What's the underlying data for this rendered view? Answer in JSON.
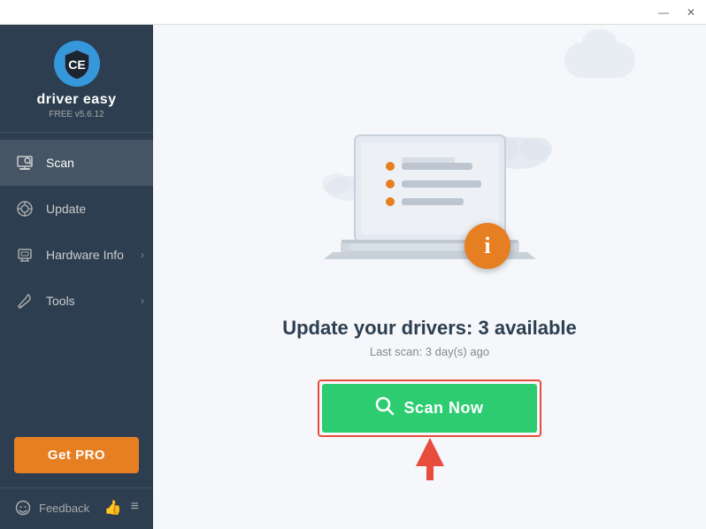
{
  "titlebar": {
    "minimize_label": "—",
    "close_label": "✕"
  },
  "sidebar": {
    "logo_text": "driver easy",
    "logo_version": "FREE v5.6.12",
    "logo_letters": "CE",
    "nav_items": [
      {
        "id": "scan",
        "label": "Scan",
        "icon": "🖥",
        "active": true,
        "has_arrow": false
      },
      {
        "id": "update",
        "label": "Update",
        "icon": "⚙",
        "active": false,
        "has_arrow": false
      },
      {
        "id": "hardware-info",
        "label": "Hardware Info",
        "icon": "💾",
        "active": false,
        "has_arrow": true
      },
      {
        "id": "tools",
        "label": "Tools",
        "icon": "🔧",
        "active": false,
        "has_arrow": true
      }
    ],
    "get_pro_label": "Get PRO",
    "feedback_label": "Feedback"
  },
  "main": {
    "title": "Update your drivers: 3 available",
    "subtitle": "Last scan: 3 day(s) ago",
    "scan_btn_label": "Scan Now"
  }
}
